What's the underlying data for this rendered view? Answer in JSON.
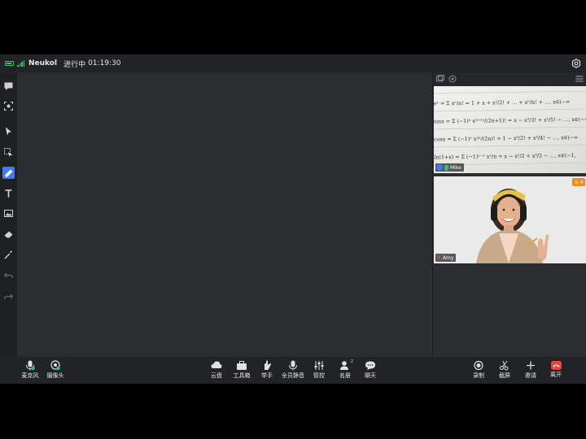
{
  "top_bar": {
    "meeting_name": "Neukol",
    "status": "进行中",
    "timer": "01:19:30"
  },
  "toolbar_left": {
    "tools": [
      "chat-icon",
      "screenshot-icon",
      "pointer-icon",
      "select-icon",
      "pen-icon",
      "text-icon",
      "image-icon",
      "eraser-icon",
      "magic-wand-icon",
      "undo-icon",
      "redo-icon"
    ],
    "active_tool": "pen-icon"
  },
  "participants": [
    {
      "name": "Mike",
      "mic": "on"
    },
    {
      "name": "Amy",
      "mic": "off",
      "hand_count": "4"
    }
  ],
  "whiteboard_video": {
    "lines": [
      "eˣ = Σ xⁿ/n! = 1 + x + x²/2! + … + xⁿ/n! + …,  x∈(−∞",
      "sinx = Σ (−1)ⁿ x²ⁿ⁺¹/(2n+1)! = x − x³/3! + x⁵/5! − …,  x∈(−∞",
      "cosx = Σ (−1)ⁿ x²ⁿ/(2n)! = 1 − x²/2! + x⁴/4! − …,  x∈(−∞",
      "ln(1+x) = Σ (−1)ⁿ⁻¹ xⁿ/n = x − x²/2 + x³/3 − …,  x∈(−1,"
    ]
  },
  "bottom_bar": {
    "left": [
      {
        "label": "麦克风",
        "icon": "microphone-icon"
      },
      {
        "label": "摄像头",
        "icon": "camera-icon"
      }
    ],
    "center": [
      {
        "label": "云盘",
        "icon": "cloud-icon"
      },
      {
        "label": "工具箱",
        "icon": "toolbox-icon"
      },
      {
        "label": "举手",
        "icon": "hand-icon"
      },
      {
        "label": "全员静音",
        "icon": "mute-all-icon"
      },
      {
        "label": "管控",
        "icon": "controls-icon"
      },
      {
        "label": "名册",
        "icon": "roster-icon",
        "badge": "2"
      },
      {
        "label": "聊天",
        "icon": "chat-icon"
      }
    ],
    "right": [
      {
        "label": "录制",
        "icon": "record-icon"
      },
      {
        "label": "截屏",
        "icon": "scissors-icon"
      },
      {
        "label": "邀请",
        "icon": "plus-icon"
      },
      {
        "label": "离开",
        "icon": "leave-phone-icon"
      }
    ]
  },
  "colors": {
    "accent": "#3e7bf5",
    "leave": "#e5453c",
    "mic_on": "#2fbf7a",
    "battery": "#39c86a",
    "hand_badge": "#f08a24"
  }
}
